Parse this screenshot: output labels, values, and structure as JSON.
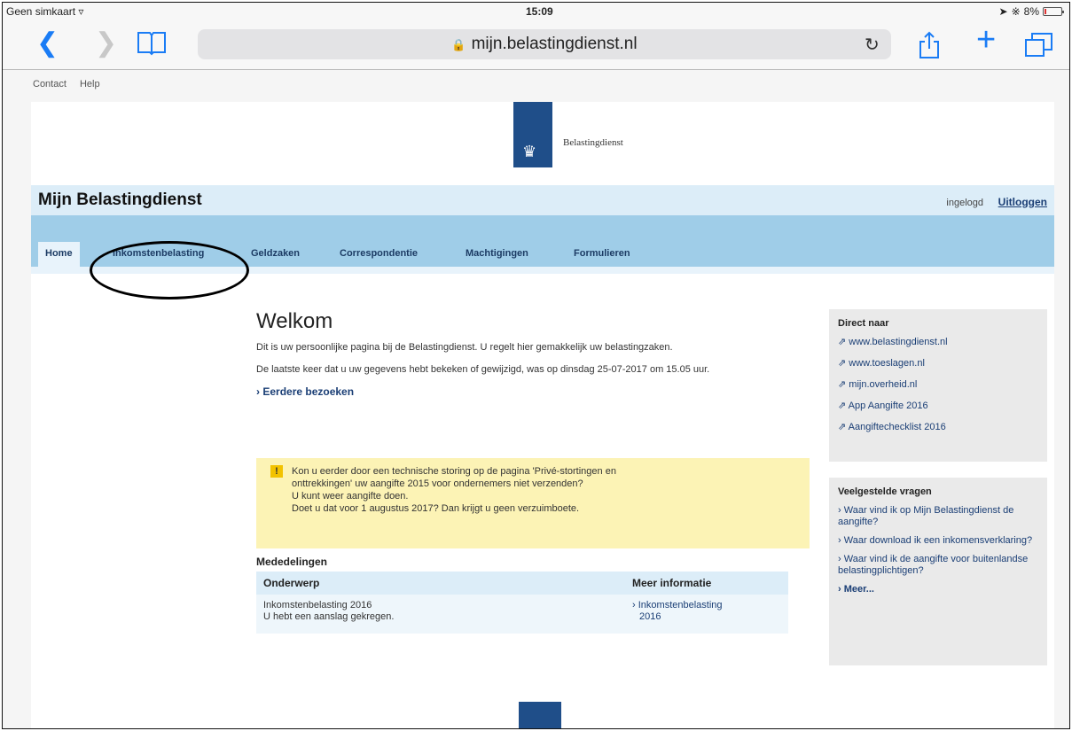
{
  "statusbar": {
    "carrier": "Geen simkaart",
    "time": "15:09",
    "battery": "8%"
  },
  "browser": {
    "url": "mijn.belastingdienst.nl"
  },
  "topnav": {
    "contact": "Contact",
    "help": "Help"
  },
  "brand": {
    "logo_text": "Belastingdienst",
    "site_title": "Mijn Belastingdienst",
    "login_status": "ingelogd",
    "logout": "Uitloggen"
  },
  "tabs": [
    {
      "label": "Home"
    },
    {
      "label": "Inkomstenbelasting"
    },
    {
      "label": "Geldzaken"
    },
    {
      "label": "Correspondentie"
    },
    {
      "label": "Machtigingen"
    },
    {
      "label": "Formulieren"
    }
  ],
  "main": {
    "title": "Welkom",
    "intro": "Dit is uw persoonlijke pagina bij de Belastingdienst. U regelt hier gemakkelijk uw belastingzaken.",
    "last_visit": "De laatste keer dat u uw gegevens hebt bekeken of gewijzigd, was op dinsdag 25-07-2017 om 15.05 uur.",
    "earlier_visits": "Eerdere bezoeken"
  },
  "alert": {
    "line1": "Kon u eerder door een technische storing op de pagina 'Privé-stortingen en",
    "line2": "onttrekkingen' uw aangifte 2015 voor ondernemers niet verzenden?",
    "line3": "U kunt weer aangifte doen.",
    "line4": "Doet u dat voor 1 augustus 2017? Dan krijgt u geen verzuimboete."
  },
  "announcements": {
    "heading": "Mededelingen",
    "col_subject": "Onderwerp",
    "col_info": "Meer informatie",
    "row_subject_1": "Inkomstenbelasting 2016",
    "row_subject_2": "U hebt een aanslag gekregen.",
    "row_info_1": "Inkomstenbelasting",
    "row_info_2": "2016"
  },
  "direct": {
    "heading": "Direct naar",
    "links": [
      "www.belastingdienst.nl",
      "www.toeslagen.nl",
      "mijn.overheid.nl",
      "App Aangifte 2016",
      "Aangiftechecklist 2016"
    ]
  },
  "faq": {
    "heading": "Veelgestelde vragen",
    "q1": "Waar vind ik op Mijn Belastingdienst de aangifte?",
    "q2": "Waar download ik een inkomensverklaring?",
    "q3": "Waar vind ik de aangifte voor buitenlandse belastingplichtigen?",
    "more": "Meer..."
  }
}
